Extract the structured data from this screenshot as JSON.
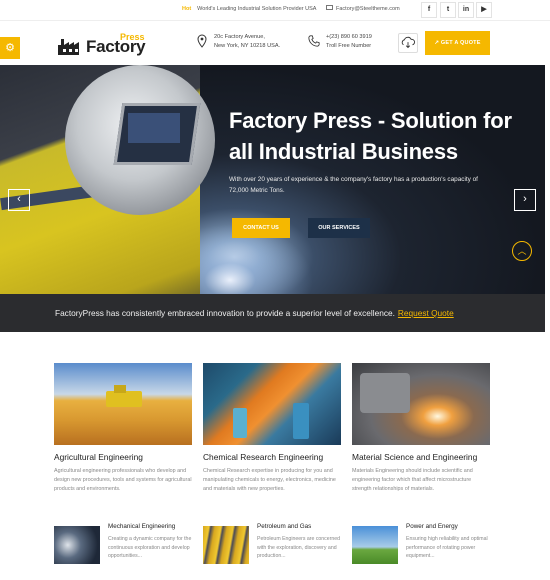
{
  "topbar": {
    "hot_label": "Hot",
    "tagline": "World's Leading Industrial Solution Provider USA",
    "email": "Factory@Steeltheme.com",
    "social": [
      {
        "name": "facebook",
        "glyph": "f"
      },
      {
        "name": "twitter",
        "glyph": "t"
      },
      {
        "name": "linkedin",
        "glyph": "in"
      },
      {
        "name": "youtube",
        "glyph": "▶"
      }
    ]
  },
  "header": {
    "logo": {
      "press": "Press",
      "name": "Factory"
    },
    "address": {
      "line1": "20c Factory Avenue,",
      "line2": "New York, NY 10218 USA."
    },
    "phone": {
      "line1": "+(23) 890 60 3919",
      "line2": "Troll Free Number"
    },
    "quote_button": "↗ GET A QUOTE",
    "colors": {
      "accent": "#f5b800",
      "navy": "#1d3048"
    }
  },
  "hero": {
    "title": "Factory Press - Solution for all Industrial Business",
    "lead": "With over 20 years of experience & the company's factory has a production's capacity of 72,000 Metric Tons.",
    "contact_button": "CONTACT US",
    "services_button": "OUR SERVICES",
    "prev_glyph": "‹",
    "next_glyph": "›",
    "scroll_glyph": "︿"
  },
  "banner": {
    "text": "FactoryPress has consistently embraced innovation to provide a superior level of excellence.",
    "link": "Request Quote"
  },
  "services": [
    {
      "title": "Agricultural Engineering",
      "text": "Agricultural engineering professionals who develop and design new procedures, tools and systems for agricultural products and environments."
    },
    {
      "title": "Chemical Research Engineering",
      "text": "Chemical Research expertise in producing for you and manipulating chemicals to energy, electronics, medicine and materials with new properties."
    },
    {
      "title": "Material Science and Engineering",
      "text": "Materials Engineering should include scientific and engineering factor which that affect microstructure strength relationships of materials."
    }
  ],
  "small_services": [
    {
      "title": "Mechanical Engineering",
      "text": "Creating a dynamic company for the continuous exploration and develop opportunities..."
    },
    {
      "title": "Petroleum and Gas",
      "text": "Petroleum Engineers are concerned with the exploration, discovery and production..."
    },
    {
      "title": "Power and Energy",
      "text": "Ensuring high reliability and optimal performance of rotating power equipment..."
    }
  ]
}
